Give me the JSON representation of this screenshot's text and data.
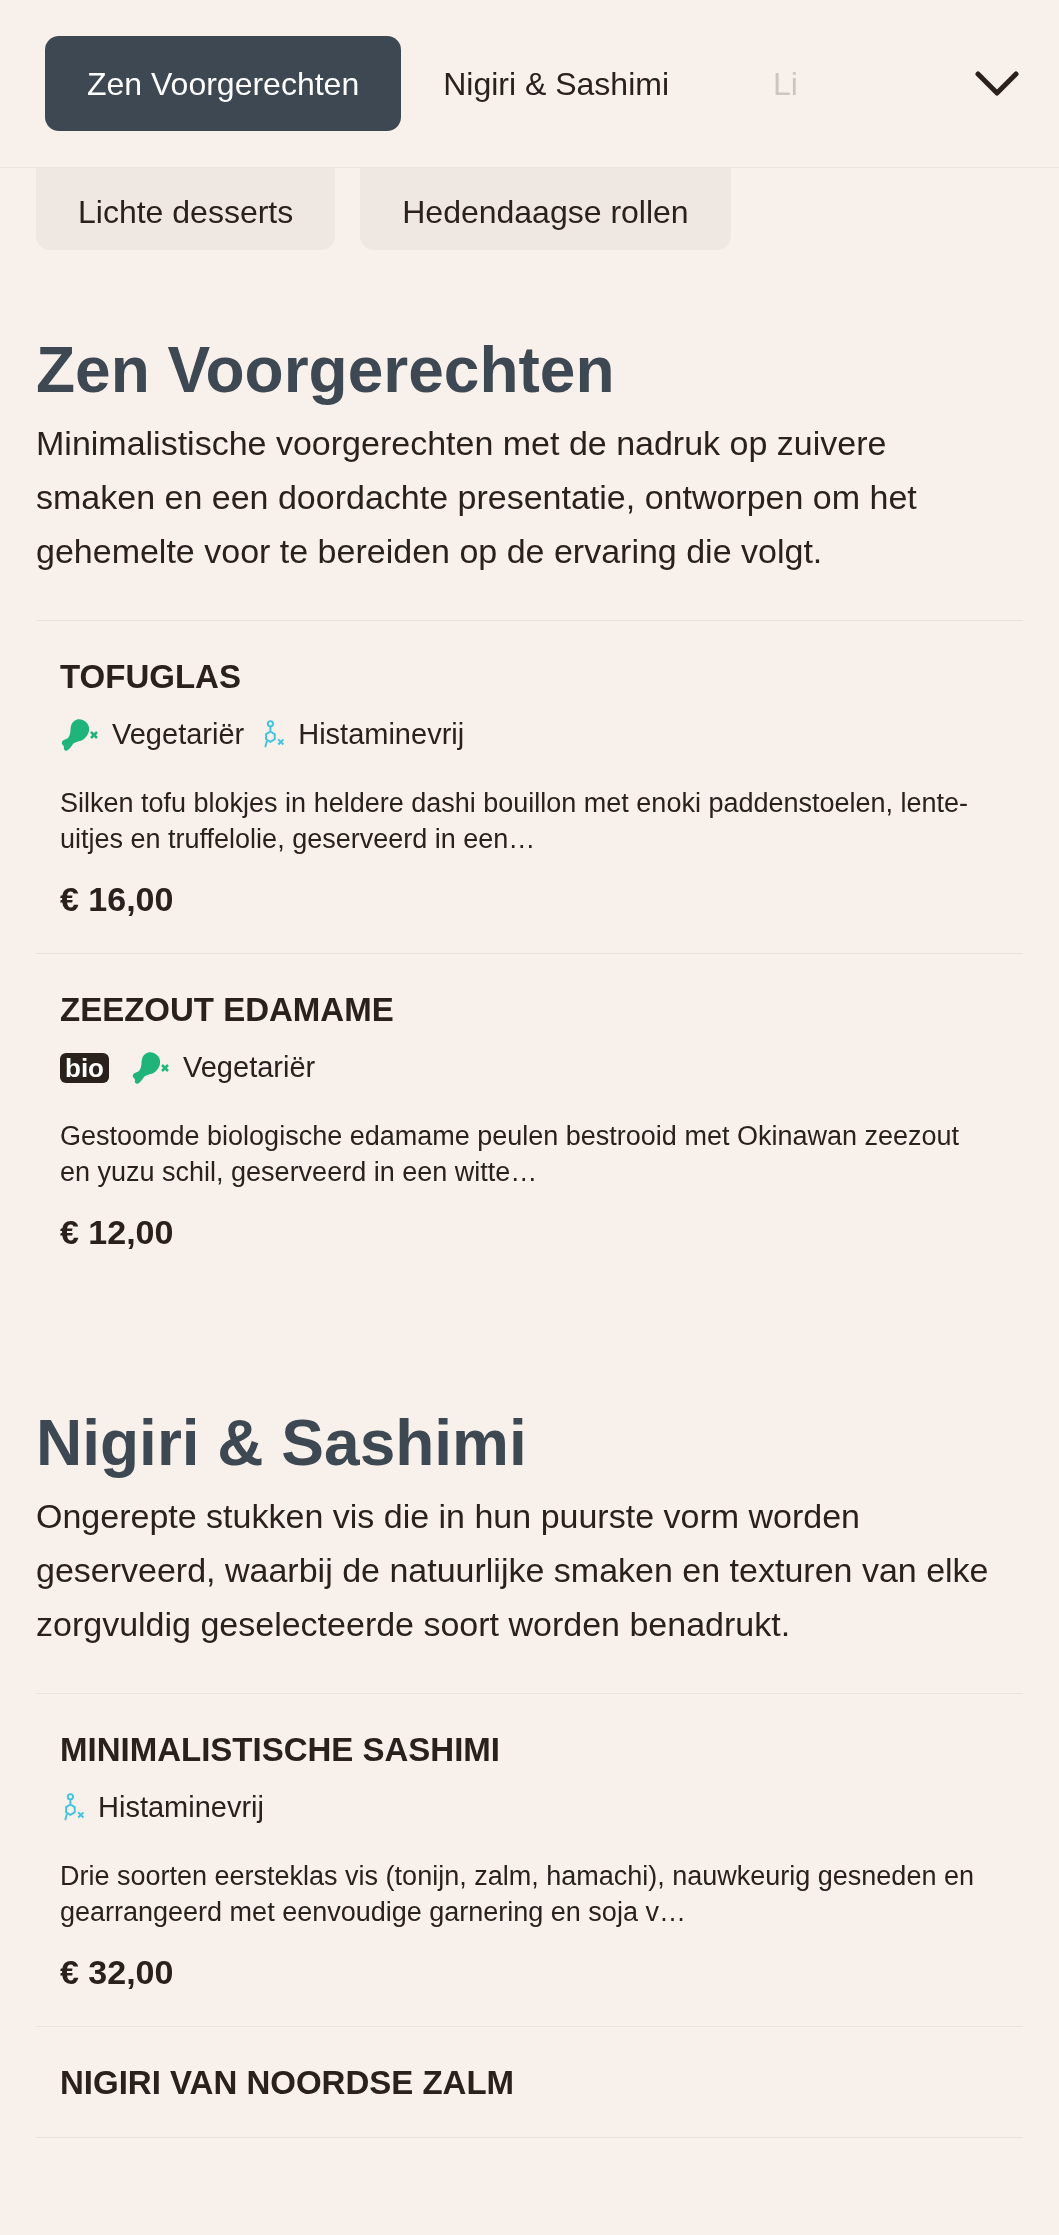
{
  "nav": {
    "tabs": [
      {
        "label": "Zen Voorgerechten",
        "selected": true
      },
      {
        "label": "Nigiri & Sashimi",
        "selected": false
      },
      {
        "label": "Li",
        "selected": false
      }
    ]
  },
  "more_categories": [
    {
      "label": "Lichte desserts",
      "selected": false
    },
    {
      "label": "Hedendaagse rollen",
      "selected": false
    }
  ],
  "sections": [
    {
      "title": "Zen Voorgerechten",
      "description": "Minimalistische voorgerechten met de nadruk op zuivere smaken en een doordachte presentatie, ontworpen om het gehemelte voor te bereiden op de ervaring die volgt.",
      "items": [
        {
          "name": "TOFUGLAS",
          "tags": [
            {
              "kind": "vegetarian",
              "label": "Vegetariër"
            },
            {
              "kind": "histamine_free",
              "label": "Histaminevrij"
            }
          ],
          "description": "Silken tofu blokjes in heldere dashi bouillon met enoki paddenstoelen, lente-uitjes en truffelolie, geserveerd in een…",
          "price": "€ 16,00"
        },
        {
          "name": "ZEEZOUT EDAMAME",
          "tags": [
            {
              "kind": "bio",
              "label": "bio"
            },
            {
              "kind": "vegetarian",
              "label": "Vegetariër"
            }
          ],
          "description": "Gestoomde biologische edamame peulen bestrooid met Okinawan zeezout en yuzu schil, geserveerd in een witte…",
          "price": "€ 12,00"
        }
      ]
    },
    {
      "title": "Nigiri & Sashimi",
      "description": "Ongerepte stukken vis die in hun puurste vorm worden geserveerd, waarbij de natuurlijke smaken en texturen van elke zorgvuldig geselecteerde soort worden benadrukt.",
      "items": [
        {
          "name": "MINIMALISTISCHE SASHIMI",
          "tags": [
            {
              "kind": "histamine_free",
              "label": "Histaminevrij"
            }
          ],
          "description": "Drie soorten eersteklas vis (tonijn, zalm, hamachi), nauwkeurig gesneden en gearrangeerd met eenvoudige garnering en soja v…",
          "price": "€ 32,00"
        },
        {
          "name": "NIGIRI VAN NOORDSE ZALM"
        }
      ]
    }
  ]
}
